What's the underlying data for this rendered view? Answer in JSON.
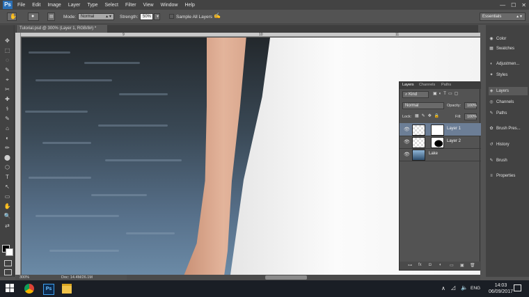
{
  "menubar": {
    "logo": "Ps",
    "items": [
      "File",
      "Edit",
      "Image",
      "Layer",
      "Type",
      "Select",
      "Filter",
      "View",
      "Window",
      "Help"
    ],
    "controls": [
      "—",
      "☐",
      "✕"
    ]
  },
  "options": {
    "mode_label": "Mode:",
    "mode_value": "Normal",
    "strength_label": "Strength:",
    "strength_value": "50%",
    "sample_all_layers": "Sample All Layers",
    "workspace": "Essentials"
  },
  "document": {
    "tab_title": "Tutorial.psd @ 300% (Layer 1, RGB/8#) *",
    "ruler_ticks": [
      "9",
      "10",
      "11"
    ],
    "zoom": "300%",
    "doc_info": "Doc: 14.4M/26.1M"
  },
  "tools": [
    "✥",
    "⬚",
    "◌",
    "✎",
    "⌖",
    "✂",
    "✚",
    "⚕",
    "✎",
    "⌂",
    "◐",
    "✏",
    "⬤",
    "⬡",
    "T",
    "↖",
    "▭",
    "✋",
    "🔍",
    "⇄"
  ],
  "dock": {
    "items": [
      {
        "icon": "◉",
        "label": "Color"
      },
      {
        "icon": "▦",
        "label": "Swatches"
      },
      {
        "icon": "◐",
        "label": "Adjustmen..."
      },
      {
        "icon": "✦",
        "label": "Styles"
      },
      {
        "icon": "◈",
        "label": "Layers"
      },
      {
        "icon": "◎",
        "label": "Channels"
      },
      {
        "icon": "✎",
        "label": "Paths"
      },
      {
        "icon": "✿",
        "label": "Brush Pres..."
      },
      {
        "icon": "↺",
        "label": "History"
      },
      {
        "icon": "✎",
        "label": "Brush"
      },
      {
        "icon": "≡",
        "label": "Properties"
      }
    ]
  },
  "layers_panel": {
    "tabs": [
      "Layers",
      "Channels",
      "Paths"
    ],
    "kind_label": "Kind",
    "blend_mode": "Normal",
    "opacity_label": "Opacity:",
    "opacity_value": "100%",
    "lock_label": "Lock:",
    "fill_label": "Fill:",
    "fill_value": "100%",
    "layers": [
      {
        "name": "Layer 1",
        "selected": true
      },
      {
        "name": "Layer 2",
        "selected": false
      },
      {
        "name": "Lake",
        "selected": false
      }
    ],
    "bottom_icons": [
      "⊶",
      "fx",
      "◘",
      "◐",
      "▭",
      "▣",
      "🗑"
    ]
  },
  "taskbar": {
    "language": "ENG",
    "time": "14:03",
    "date": "06/09/2017"
  }
}
